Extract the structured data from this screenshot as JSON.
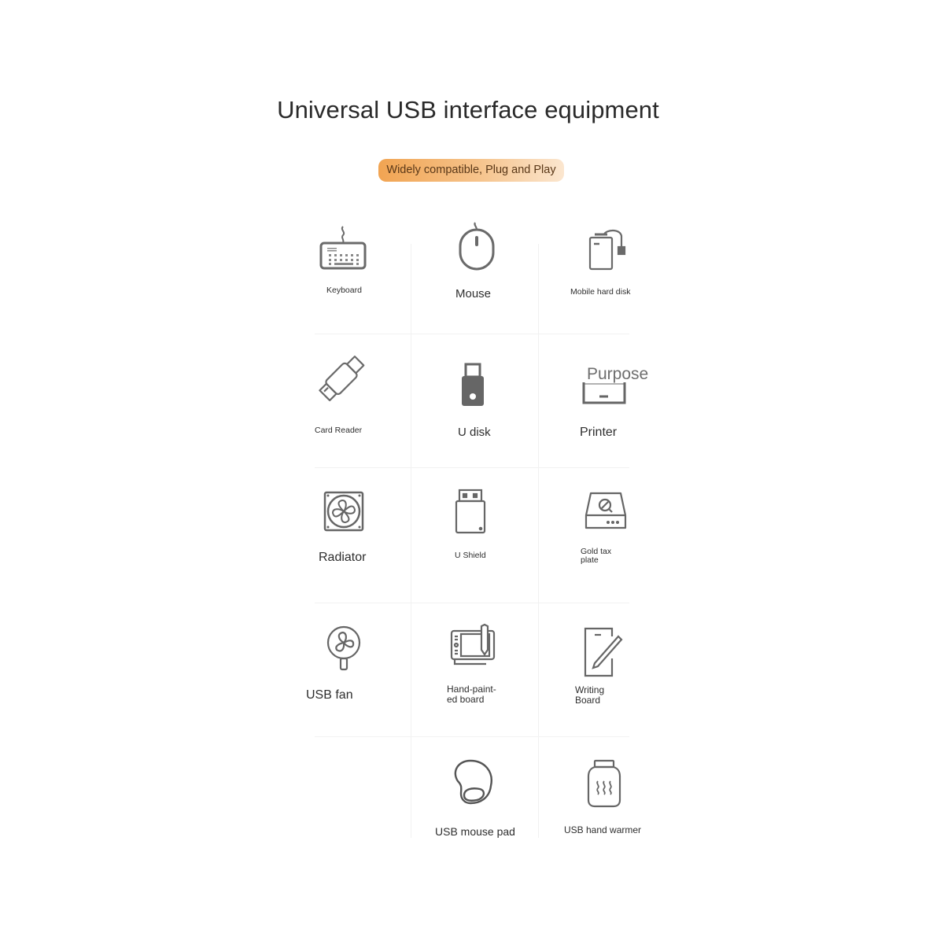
{
  "page": {
    "title": "Universal USB interface equipment",
    "badge": "Widely compatible, Plug and Play",
    "badge_gradient": [
      "#f1a452",
      "#fbe6cf"
    ]
  },
  "items": [
    {
      "label": "Keyboard",
      "icon": "keyboard-icon"
    },
    {
      "label": "Mouse",
      "icon": "mouse-icon"
    },
    {
      "label": "Mobile hard disk",
      "icon": "hard-disk-icon"
    },
    {
      "label": "Card Reader",
      "icon": "card-reader-icon"
    },
    {
      "label": "U disk",
      "icon": "usb-stick-icon"
    },
    {
      "label": "Printer",
      "icon": "printer-icon",
      "overlay": "Purpose"
    },
    {
      "label": "Radiator",
      "icon": "radiator-fan-icon"
    },
    {
      "label": "U Shield",
      "icon": "usb-key-icon"
    },
    {
      "label_lines": [
        "Gold tax",
        "plate"
      ],
      "icon": "tax-disk-icon"
    },
    {
      "label": "USB fan",
      "icon": "desk-fan-icon"
    },
    {
      "label_lines": [
        "Hand-paint-",
        "ed board"
      ],
      "icon": "drawing-tablet-icon"
    },
    {
      "label_lines": [
        "Writing",
        "Board"
      ],
      "icon": "writing-board-icon"
    },
    {
      "label": "USB mouse pad",
      "icon": "mouse-pad-icon"
    },
    {
      "label": "USB hand warmer",
      "icon": "hand-warmer-icon"
    }
  ]
}
